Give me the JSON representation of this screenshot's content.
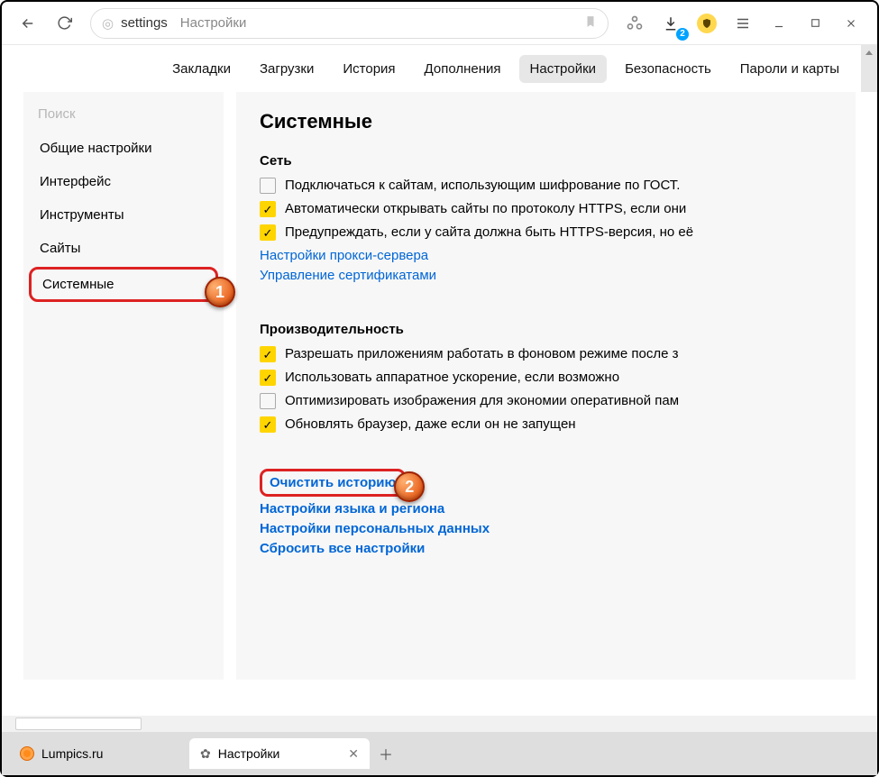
{
  "toolbar": {
    "url_scheme": "settings",
    "url_page": "Настройки",
    "download_badge": "2"
  },
  "nav": {
    "items": [
      "Закладки",
      "Загрузки",
      "История",
      "Дополнения",
      "Настройки",
      "Безопасность",
      "Пароли и карты"
    ],
    "active_index": 4
  },
  "sidebar": {
    "search_placeholder": "Поиск",
    "items": [
      "Общие настройки",
      "Интерфейс",
      "Инструменты",
      "Сайты",
      "Системные"
    ],
    "selected_index": 4
  },
  "main": {
    "title": "Системные",
    "sections": [
      {
        "title": "Сеть",
        "options": [
          {
            "checked": false,
            "label": "Подключаться к сайтам, использующим шифрование по ГОСТ."
          },
          {
            "checked": true,
            "label": "Автоматически открывать сайты по протоколу HTTPS, если они"
          },
          {
            "checked": true,
            "label": "Предупреждать, если у сайта должна быть HTTPS-версия, но её"
          }
        ],
        "links": [
          "Настройки прокси-сервера",
          "Управление сертификатами"
        ]
      },
      {
        "title": "Производительность",
        "options": [
          {
            "checked": true,
            "label": "Разрешать приложениям работать в фоновом режиме после з"
          },
          {
            "checked": true,
            "label": "Использовать аппаратное ускорение, если возможно"
          },
          {
            "checked": false,
            "label": "Оптимизировать изображения для экономии оперативной пам"
          },
          {
            "checked": true,
            "label": "Обновлять браузер, даже если он не запущен"
          }
        ]
      }
    ],
    "bottom_links": [
      "Очистить историю",
      "Настройки языка и региона",
      "Настройки персональных данных",
      "Сбросить все настройки"
    ],
    "highlighted_link_index": 0
  },
  "markers": {
    "m1": "1",
    "m2": "2"
  },
  "tabs": {
    "items": [
      {
        "label": "Lumpics.ru",
        "active": false
      },
      {
        "label": "Настройки",
        "active": true
      }
    ]
  }
}
